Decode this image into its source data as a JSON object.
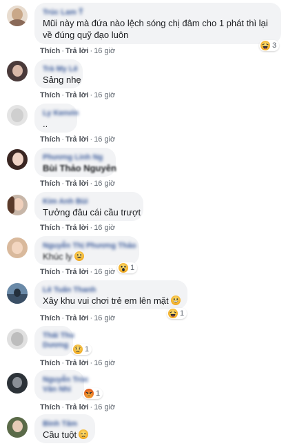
{
  "actions": {
    "like": "Thích",
    "reply": "Trả lời",
    "time": "16 giờ",
    "sep": "·"
  },
  "comments": [
    {
      "name": "Trúc Lam Ť",
      "text": "Mũi này mà đứa nào lệch sóng chị đâm cho 1 phát thì lại",
      "text2": "về đúng quỹ đạo luôn",
      "reaction": "haha",
      "count": "3"
    },
    {
      "name": "Trà My Lê",
      "text": "Sảng nhẹ"
    },
    {
      "name": "Ly Kenvin",
      "text": ".."
    },
    {
      "name": "Phương Linh Ng",
      "text": "Bùi Thảo Nguyên"
    },
    {
      "name": "Kim Anh Bùi",
      "text": "Tưởng đâu cái cầu trượt"
    },
    {
      "name": "Nguyễn Thị Phương Thảo",
      "text": "Khúc ly",
      "reaction": "wow",
      "count": "1"
    },
    {
      "name": "Lê Tuấn Thanh",
      "text": "Xây khu vui chơi trẻ em lên mặt",
      "reaction": "haha",
      "count": "1"
    },
    {
      "name": "Thái Thu",
      "name2": "Dương",
      "reaction": "sad",
      "count": "1"
    },
    {
      "name": "Nguyễn Trúc",
      "name2": "Văn Nhi",
      "reaction": "angry",
      "count": "1"
    },
    {
      "name": "Bình Tâm",
      "text": "Cầu tuột"
    }
  ],
  "colors": {
    "bubble": "#f2f3f5",
    "name": "#385898",
    "meta": "#606770",
    "emoji": "#f7b125"
  }
}
